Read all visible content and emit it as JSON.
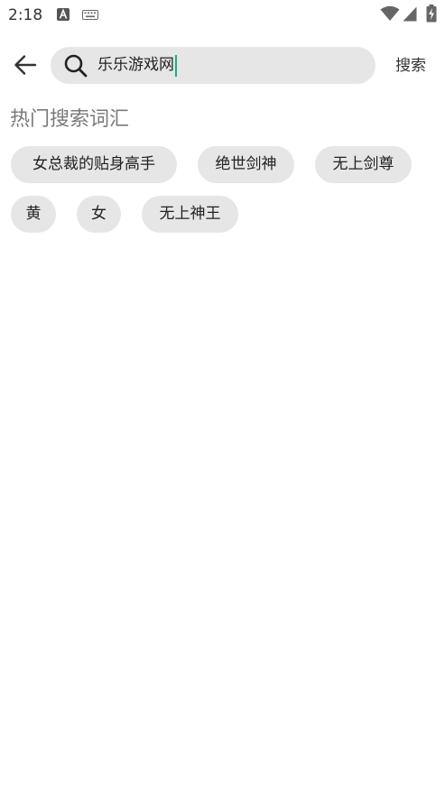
{
  "status_bar": {
    "time": "2:18",
    "icons": [
      "a-notification-icon",
      "keyboard-icon",
      "wifi-icon",
      "cell-signal-icon",
      "battery-charging-icon"
    ]
  },
  "header": {
    "back_icon": "arrow-left-icon",
    "search": {
      "icon": "search-icon",
      "value": "乐乐游戏网"
    },
    "search_button_label": "搜索"
  },
  "hot_search": {
    "title": "热门搜索词汇",
    "tags": [
      {
        "label": "女总裁的贴身高手"
      },
      {
        "label": "绝世剑神"
      },
      {
        "label": "无上剑尊"
      },
      {
        "label": "黄"
      },
      {
        "label": "女"
      },
      {
        "label": "无上神王"
      }
    ]
  },
  "colors": {
    "accent_caret": "#1fa88e",
    "pill_background": "#e6e6e6",
    "section_title": "#7a7a7a"
  }
}
